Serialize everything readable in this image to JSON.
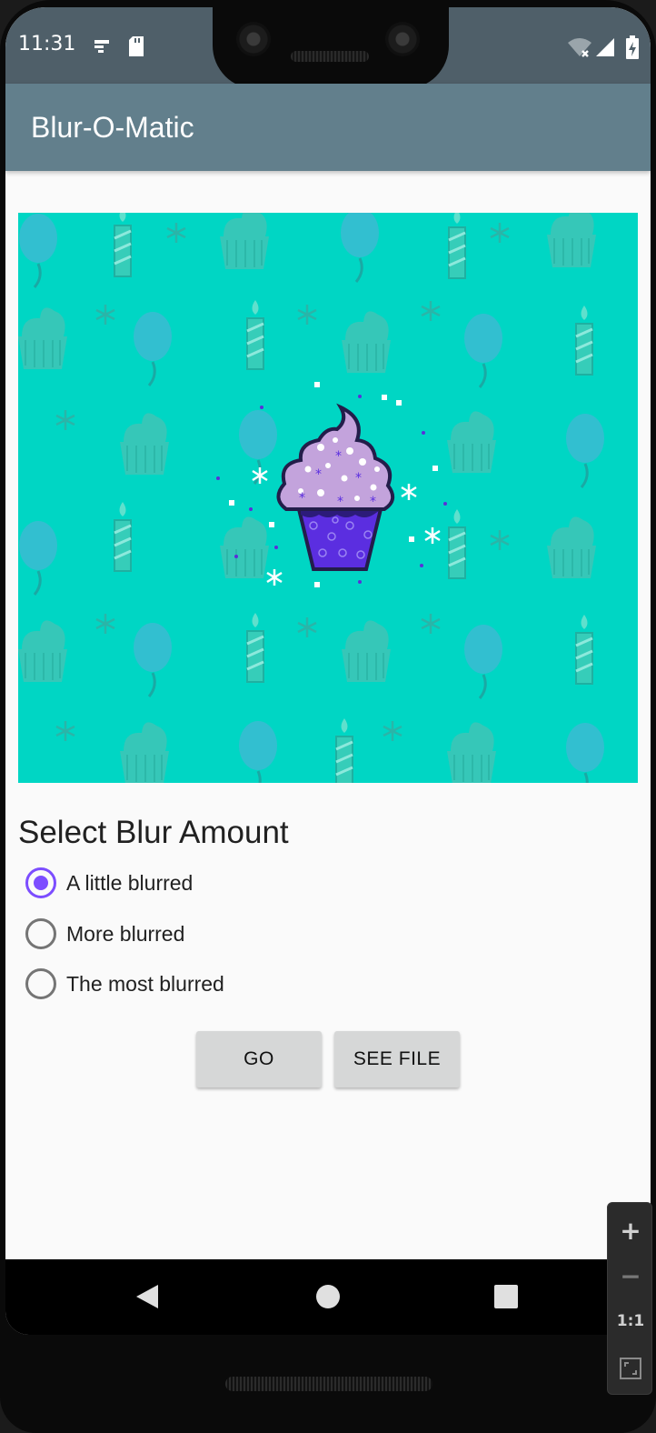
{
  "status_bar": {
    "time": "11:31",
    "icons": [
      "cast-icon",
      "sd-card-icon",
      "wifi-off-icon",
      "signal-icon",
      "battery-charging-icon"
    ]
  },
  "app_bar": {
    "title": "Blur-O-Matic"
  },
  "image": {
    "description_icon": "cupcake-image",
    "background_color": "#00d6c4"
  },
  "blur_section": {
    "title": "Select Blur Amount",
    "options": [
      {
        "label": "A little blurred",
        "checked": true
      },
      {
        "label": "More blurred",
        "checked": false
      },
      {
        "label": "The most blurred",
        "checked": false
      }
    ]
  },
  "buttons": {
    "go": "GO",
    "see_file": "SEE FILE"
  },
  "emulator_controls": {
    "zoom_in": "+",
    "zoom_out": "−",
    "actual_size": "1:1"
  },
  "colors": {
    "accent": "#7c4dff",
    "app_bar": "#627f8c",
    "status_bar": "#4f5f69"
  }
}
